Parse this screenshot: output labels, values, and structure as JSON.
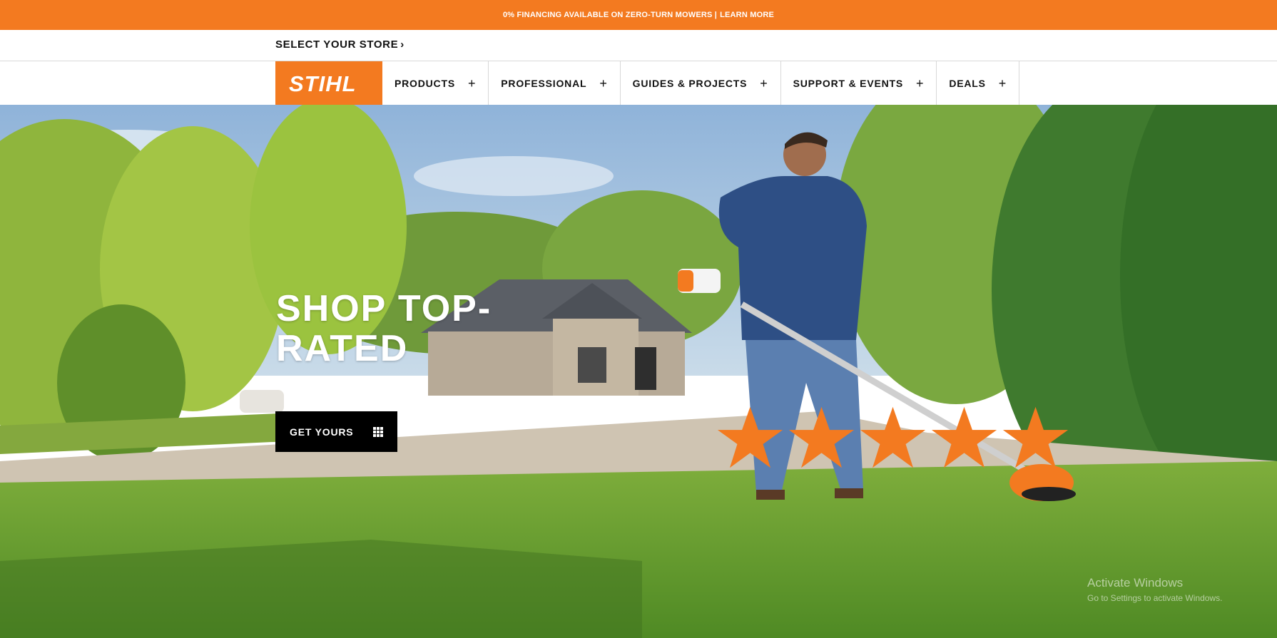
{
  "promo": {
    "text": "0% FINANCING AVAILABLE ON ZERO-TURN MOWERS |",
    "link": "LEARN MORE",
    "color": "#f37a20"
  },
  "store": {
    "label": "SELECT YOUR STORE",
    "icon": "chevron-right-icon"
  },
  "logo": {
    "text": "STIHL",
    "color": "#f37a20"
  },
  "nav": {
    "items": [
      {
        "label": "PRODUCTS",
        "icon": "plus-icon"
      },
      {
        "label": "PROFESSIONAL",
        "icon": "plus-icon"
      },
      {
        "label": "GUIDES & PROJECTS",
        "icon": "plus-icon"
      },
      {
        "label": "SUPPORT & EVENTS",
        "icon": "plus-icon"
      },
      {
        "label": "DEALS",
        "icon": "plus-icon"
      }
    ]
  },
  "hero": {
    "headline_line1": "SHOP TOP-",
    "headline_line2": "RATED",
    "cta_label": "GET YOURS",
    "cta_icon": "grid-icon",
    "rating": {
      "stars": 5,
      "max": 5,
      "color": "#f37a20"
    }
  },
  "watermark": {
    "title": "Activate Windows",
    "subtitle": "Go to Settings to activate Windows."
  }
}
